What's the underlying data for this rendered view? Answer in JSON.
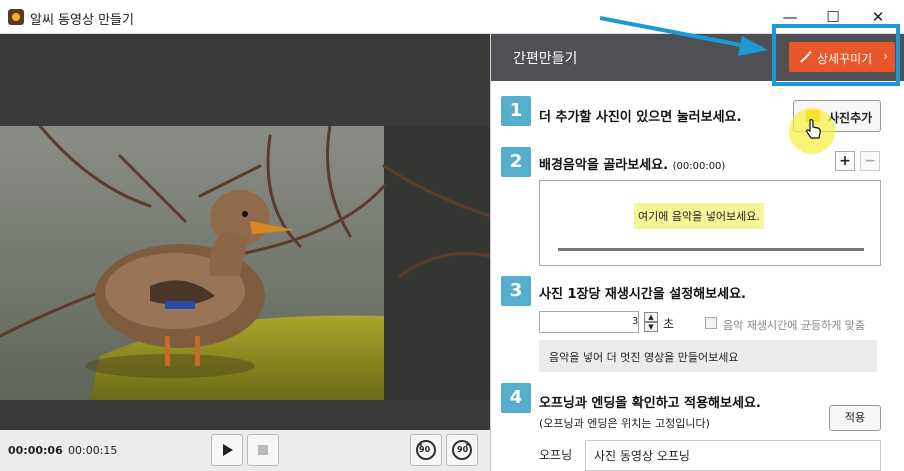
{
  "window": {
    "title": "알씨 동영상 만들기",
    "controls": {
      "minimize": "—",
      "maximize": "☐",
      "close": "✕"
    }
  },
  "player": {
    "current_time": "00:00:06",
    "total_time": "00:00:15",
    "buttons": {
      "play": "play-icon",
      "stop": "stop-icon",
      "rotate_left_label": "90",
      "rotate_right_label": "90"
    }
  },
  "panel": {
    "title": "간편만들기",
    "detail_button": "상세꾸미기",
    "detail_chevron": "›"
  },
  "steps": [
    {
      "number": "1",
      "text": "더 추가할 사진이 있으면 눌러보세요.",
      "button": "사진추가"
    },
    {
      "number": "2",
      "text": "배경음악을 골라보세요.",
      "extra": "(00:00:00)",
      "hint": "여기에 음악을 넣어보세요.",
      "add": "+",
      "remove": "−"
    },
    {
      "number": "3",
      "text": "사진 1장당 재생시간을 설정해보세요.",
      "value": "3",
      "unit": "초",
      "checkbox_label": "음악 재생시간에 균등하게 맞춤",
      "checkbox_checked": false,
      "info": "음악을 넣어 더 멋진 영상을 만들어보세요"
    },
    {
      "number": "4",
      "text": "오프닝과 엔딩을 확인하고 적용해보세요.",
      "subtext": "(오프닝과 엔딩은 위치는 고정입니다)",
      "button": "적용",
      "opening_label": "오프닝",
      "opening_value": "사진 동영상 오프닝"
    }
  ],
  "colors": {
    "accent": "#e8562a",
    "step_badge": "#55aecb",
    "header_bg": "#4e5055",
    "annotation_blue": "#1b9ad6",
    "hint_yellow": "#f7f59a"
  }
}
